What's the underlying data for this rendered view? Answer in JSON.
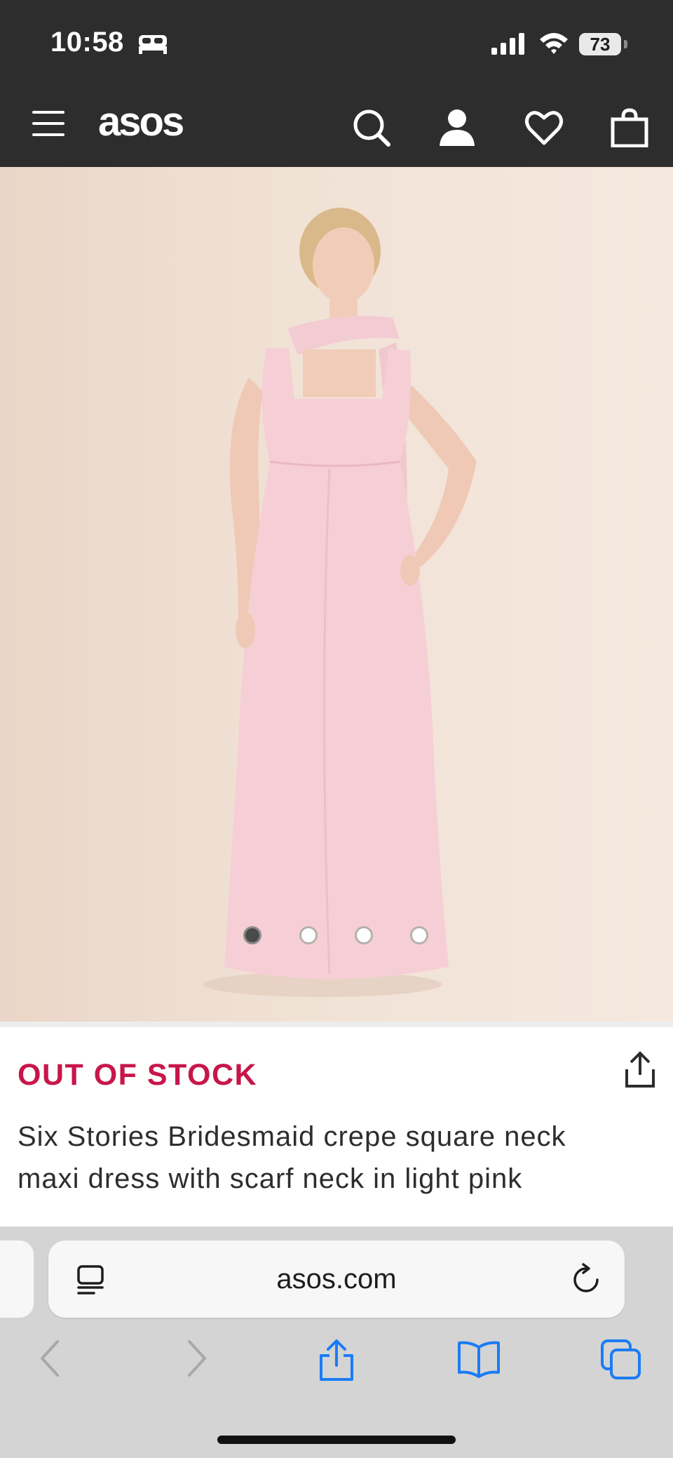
{
  "status_bar": {
    "time": "10:58",
    "battery": "73",
    "icons": [
      "bed-icon",
      "cellular-signal-icon",
      "wifi-icon",
      "battery-icon"
    ]
  },
  "nav": {
    "logo": "asos",
    "icons": [
      "menu-icon",
      "search-icon",
      "account-icon",
      "wishlist-heart-icon",
      "bag-icon"
    ]
  },
  "gallery": {
    "image_count": 4,
    "active_index": 0
  },
  "product": {
    "stock_status": "OUT OF STOCK",
    "title": "Six Stories Bridesmaid crepe square neck maxi dress with scarf neck in light pink"
  },
  "browser": {
    "url": "asos.com",
    "icons": [
      "reader-mode-icon",
      "reload-icon",
      "back-icon",
      "forward-icon",
      "share-icon",
      "bookmarks-icon",
      "tabs-icon"
    ]
  },
  "colors": {
    "header_bg": "#2d2d2d",
    "stock_status": "#c8164a",
    "safari_blue": "#1a7cf5"
  }
}
